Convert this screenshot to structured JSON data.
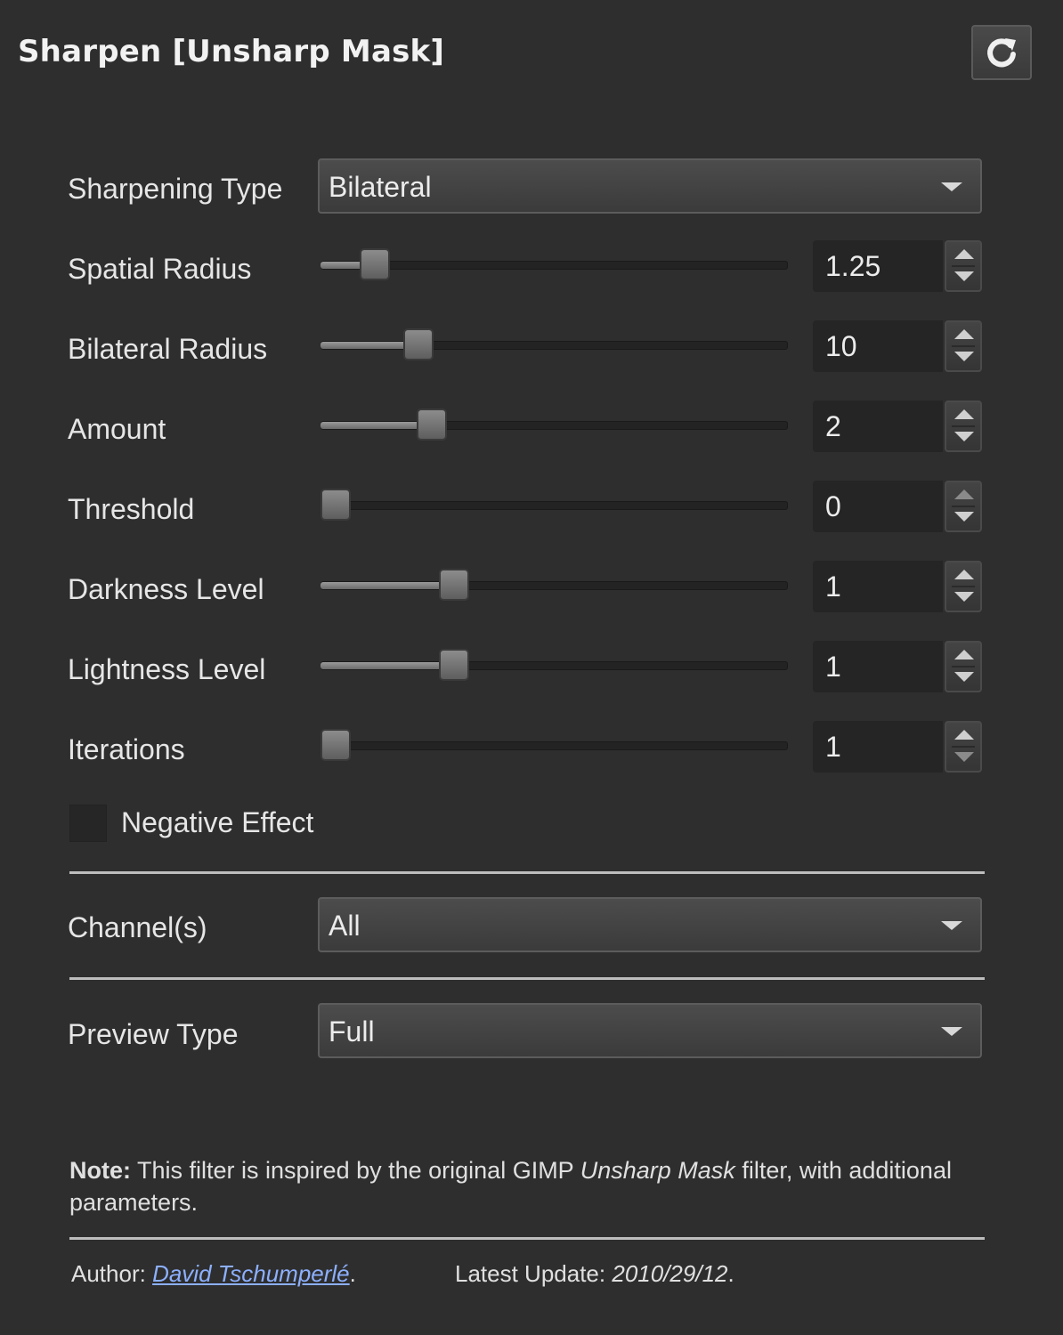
{
  "header": {
    "title": "Sharpen [Unsharp Mask]",
    "reset_icon": "refresh-icon"
  },
  "fields": {
    "sharpening_type": {
      "label": "Sharpening Type",
      "value": "Bilateral"
    },
    "spatial_radius": {
      "label": "Spatial Radius",
      "value": "1.25",
      "level": 0.09
    },
    "bilateral_radius": {
      "label": "Bilateral Radius",
      "value": "10",
      "level": 0.19
    },
    "amount": {
      "label": "Amount",
      "value": "2",
      "level": 0.22
    },
    "threshold": {
      "label": "Threshold",
      "value": "0",
      "level": 0.0
    },
    "darkness_level": {
      "label": "Darkness Level",
      "value": "1",
      "level": 0.27
    },
    "lightness_level": {
      "label": "Lightness Level",
      "value": "1",
      "level": 0.27
    },
    "iterations": {
      "label": "Iterations",
      "value": "1",
      "level": 0.0
    },
    "negative_effect": {
      "label": "Negative Effect",
      "checked": false
    },
    "channels": {
      "label": "Channel(s)",
      "value": "All"
    },
    "preview_type": {
      "label": "Preview Type",
      "value": "Full"
    }
  },
  "note": {
    "prefix": "Note:",
    "text_before": "This filter is inspired by the original GIMP",
    "italic": "Unsharp Mask",
    "text_after": "filter, with additional parameters."
  },
  "footer": {
    "author_label": "Author:",
    "author_name": "David Tschumperlé",
    "author_suffix": ".",
    "update_label": "Latest Update:",
    "update_value": "2010/29/12",
    "update_suffix": "."
  }
}
